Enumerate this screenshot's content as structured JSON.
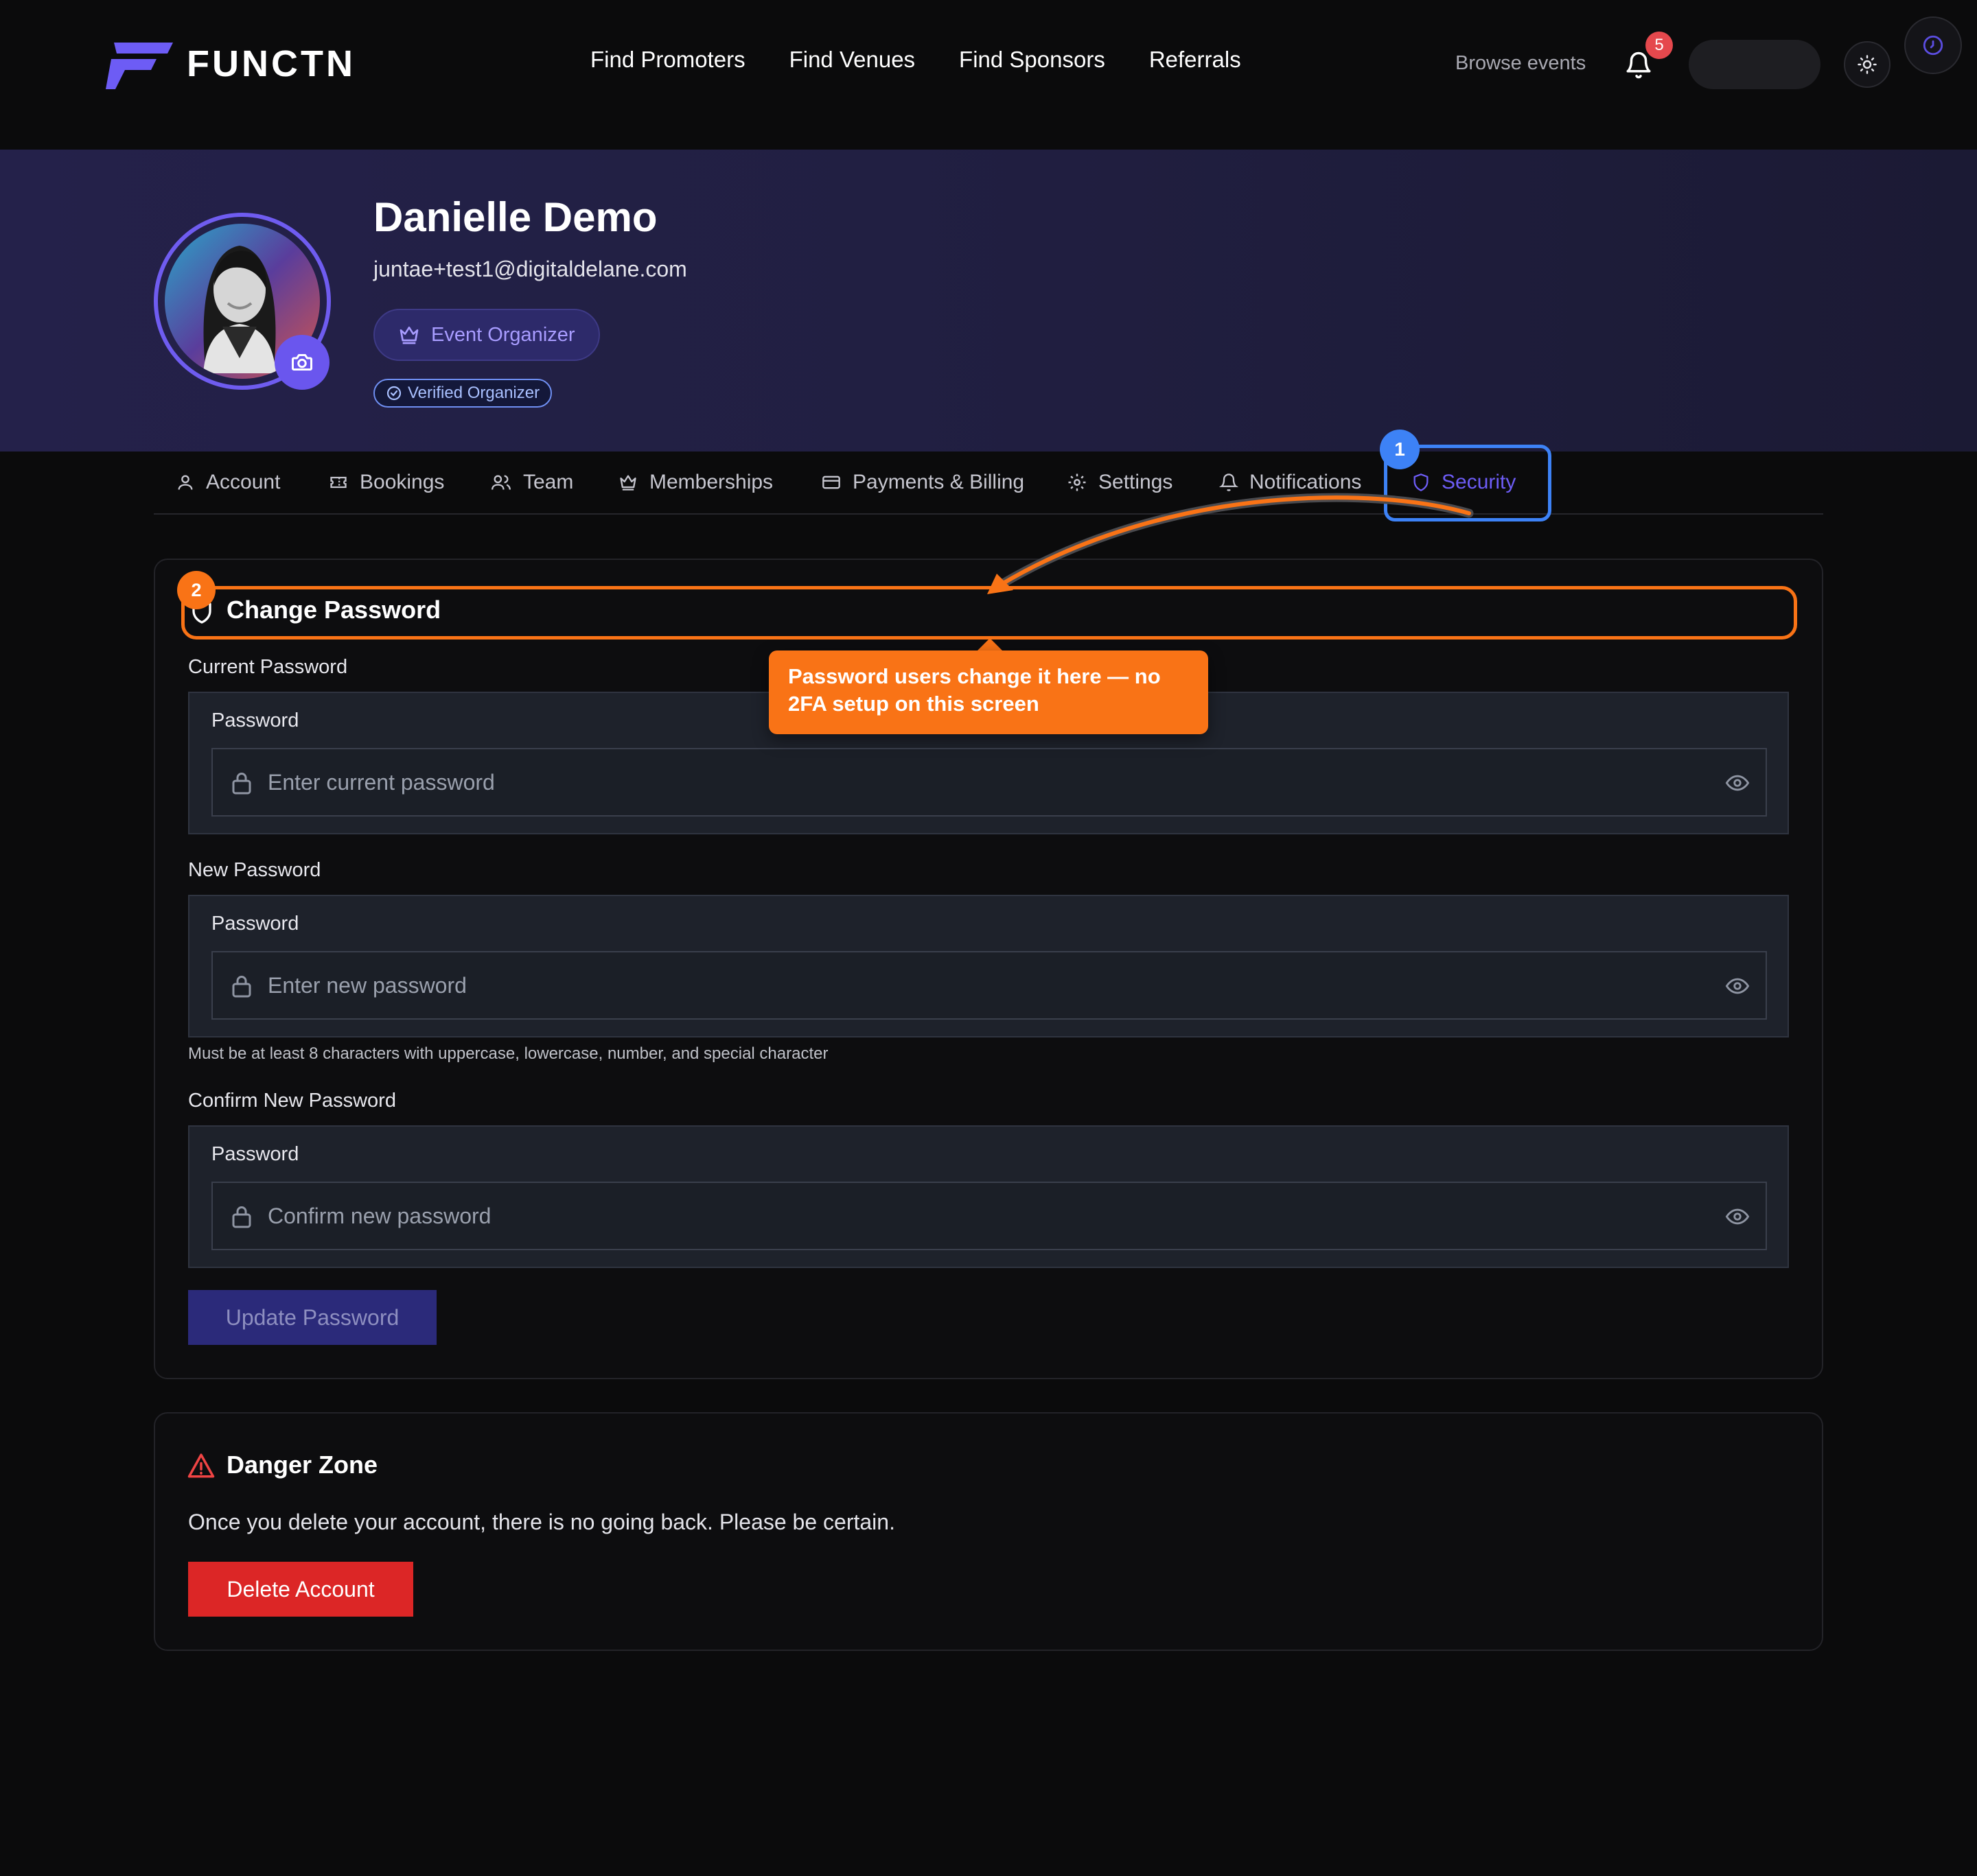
{
  "brand": {
    "name": "FUNCTN",
    "logo_color": "#6d5cf5"
  },
  "nav": {
    "links": [
      "Find Promoters",
      "Find Venues",
      "Find Sponsors",
      "Referrals"
    ],
    "browse_events": "Browse events",
    "notification_count": "5"
  },
  "profile": {
    "name": "Danielle Demo",
    "email": "juntae+test1@digitaldelane.com",
    "role": "Event Organizer",
    "verified": "Verified Organizer"
  },
  "tabs": [
    {
      "label": "Account",
      "icon": "user-icon"
    },
    {
      "label": "Bookings",
      "icon": "ticket-icon"
    },
    {
      "label": "Team",
      "icon": "users-icon"
    },
    {
      "label": "Memberships",
      "icon": "crown-icon"
    },
    {
      "label": "Payments & Billing",
      "icon": "credit-card-icon"
    },
    {
      "label": "Settings",
      "icon": "gear-icon"
    },
    {
      "label": "Notifications",
      "icon": "bell-icon"
    },
    {
      "label": "Security",
      "icon": "shield-icon",
      "active": true
    }
  ],
  "change_password": {
    "title": "Change Password",
    "current": {
      "label": "Current Password",
      "inner_label": "Password",
      "placeholder": "Enter current password"
    },
    "new": {
      "label": "New Password",
      "inner_label": "Password",
      "placeholder": "Enter new password"
    },
    "hint": "Must be at least 8 characters with uppercase, lowercase, number, and special character",
    "confirm": {
      "label": "Confirm New Password",
      "inner_label": "Password",
      "placeholder": "Confirm new password"
    },
    "submit": "Update Password"
  },
  "danger_zone": {
    "title": "Danger Zone",
    "text": "Once you delete your account, there is no going back. Please be certain.",
    "button": "Delete Account"
  },
  "annotations": {
    "step1": "1",
    "step2": "2",
    "callout": "Password users change it here — no 2FA setup on this screen",
    "colors": {
      "step1": "#3d82f6",
      "step2": "#f97316"
    }
  }
}
